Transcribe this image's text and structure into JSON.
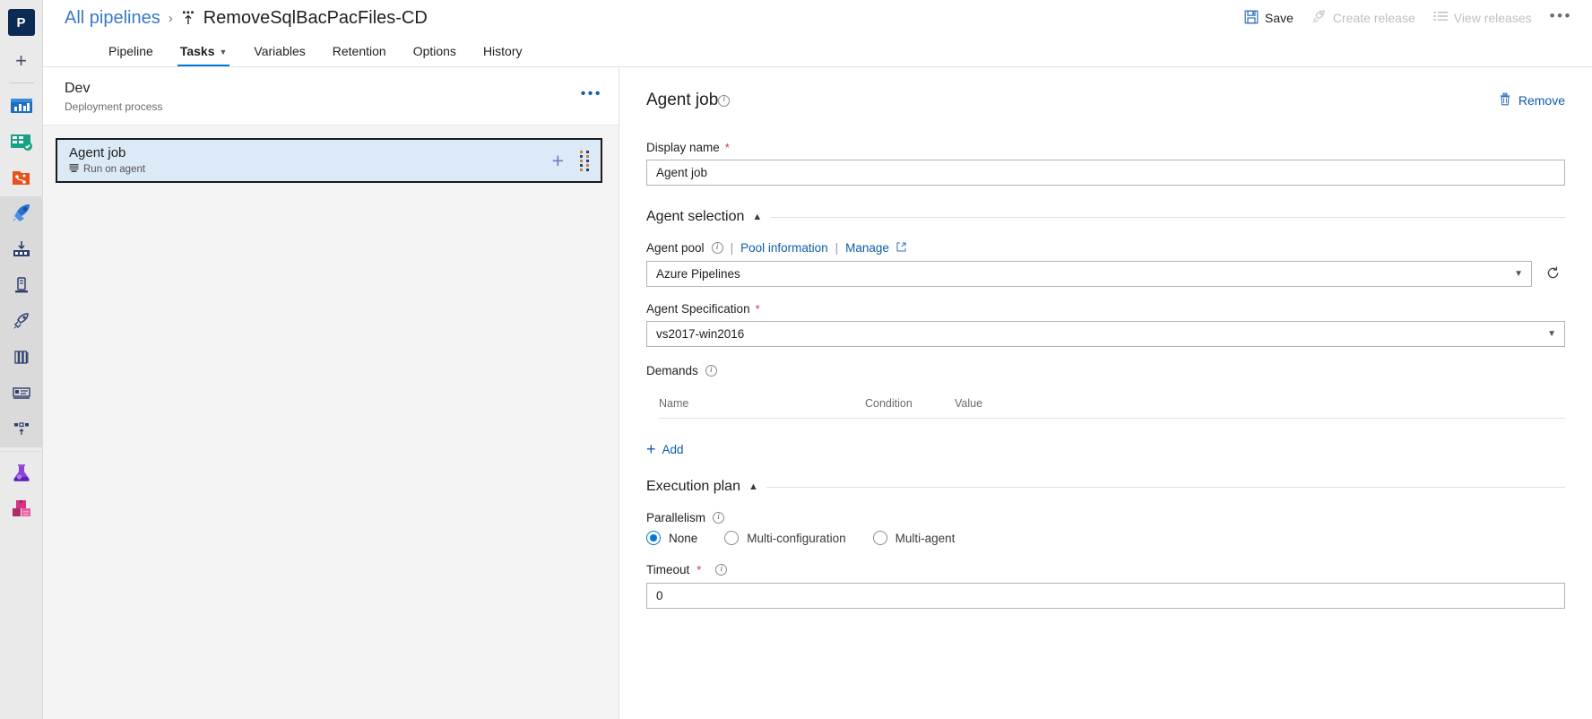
{
  "rail": {
    "logo": "P",
    "add_label": "+",
    "items": [
      {
        "name": "overview-icon",
        "label": "Overview"
      },
      {
        "name": "boards-icon",
        "label": "Boards"
      },
      {
        "name": "repos-icon",
        "label": "Repos"
      },
      {
        "name": "pipelines-icon",
        "label": "Pipelines"
      },
      {
        "name": "builds-icon",
        "label": "Builds"
      },
      {
        "name": "releases-icon",
        "label": "Releases"
      },
      {
        "name": "launch-icon",
        "label": "Deployment groups"
      },
      {
        "name": "library-icon",
        "label": "Library"
      },
      {
        "name": "task-groups-icon",
        "label": "Task groups"
      },
      {
        "name": "deployment-groups-icon",
        "label": "Deployment groups"
      },
      {
        "name": "test-plans-icon",
        "label": "Test Plans"
      },
      {
        "name": "artifacts-icon",
        "label": "Artifacts"
      }
    ]
  },
  "header": {
    "breadcrumb_link": "All pipelines",
    "breadcrumb_sep": "›",
    "title": "RemoveSqlBacPacFiles-CD",
    "save_label": "Save",
    "create_release_label": "Create release",
    "view_releases_label": "View releases",
    "more_label": "•••"
  },
  "tabs": [
    {
      "label": "Pipeline",
      "active": false,
      "has_chevron": false
    },
    {
      "label": "Tasks",
      "active": true,
      "has_chevron": true
    },
    {
      "label": "Variables",
      "active": false,
      "has_chevron": false
    },
    {
      "label": "Retention",
      "active": false,
      "has_chevron": false
    },
    {
      "label": "Options",
      "active": false,
      "has_chevron": false
    },
    {
      "label": "History",
      "active": false,
      "has_chevron": false
    }
  ],
  "left_pane": {
    "process_title": "Dev",
    "process_subtitle": "Deployment process",
    "process_menu": "•••",
    "job": {
      "title": "Agent job",
      "subtitle": "Run on agent",
      "add_label": "+"
    }
  },
  "form": {
    "title": "Agent job",
    "remove_label": "Remove",
    "display_name": {
      "label": "Display name",
      "required": "*",
      "value": "Agent job"
    },
    "agent_selection": {
      "section_label": "Agent selection",
      "chevron": "⌃",
      "agent_pool": {
        "label": "Agent pool",
        "separator": "|",
        "pool_information_label": "Pool information",
        "manage_label": "Manage",
        "value": "Azure Pipelines",
        "caret": "∨"
      },
      "agent_specification": {
        "label": "Agent Specification",
        "required": "*",
        "value": "vs2017-win2016",
        "caret": "∨"
      },
      "demands": {
        "label": "Demands",
        "columns": [
          "Name",
          "Condition",
          "Value"
        ],
        "rows": [],
        "add_label": "Add",
        "add_plus": "+"
      }
    },
    "execution_plan": {
      "section_label": "Execution plan",
      "chevron": "⌃",
      "parallelism": {
        "label": "Parallelism",
        "options": [
          {
            "label": "None",
            "selected": true
          },
          {
            "label": "Multi-configuration",
            "selected": false
          },
          {
            "label": "Multi-agent",
            "selected": false
          }
        ]
      },
      "timeout": {
        "label": "Timeout",
        "required": "*",
        "value": "0"
      }
    }
  },
  "colors": {
    "accent": "#0078d4",
    "link": "#0b5cab",
    "breadcrumb_link": "#3b78c4",
    "required": "#d13438",
    "selected_card_bg": "#dce9f7",
    "rail_bg": "#eaeaea"
  }
}
